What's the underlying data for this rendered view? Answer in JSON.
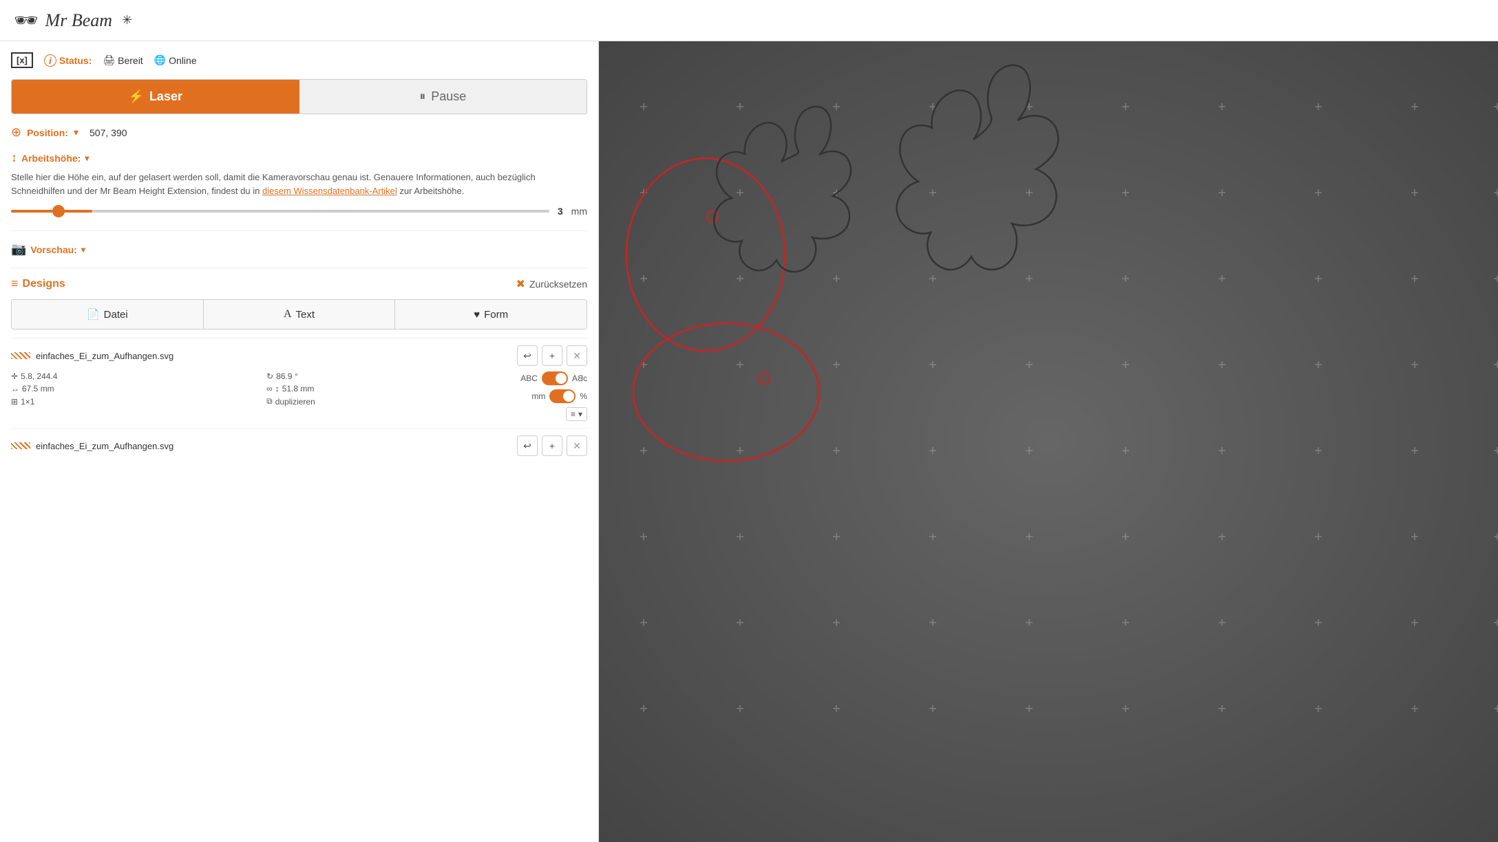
{
  "header": {
    "logo_text": "Mr Beam",
    "logo_glasses": "👓",
    "logo_star": "✳"
  },
  "status_bar": {
    "x_label": "[x]",
    "status_label": "Status:",
    "bereit_label": "Bereit",
    "online_label": "Online"
  },
  "buttons": {
    "laser_label": "Laser",
    "pause_label": "Pause"
  },
  "position": {
    "label": "Position:",
    "value": "507, 390"
  },
  "arbeitshohe": {
    "label": "Arbeitshöhe:",
    "description": "Stelle hier die Höhe ein, auf der gelasert werden soll, damit die Kameravorschau genau ist. Genauere Informationen, auch bezüglich Schneidhilfen und der Mr Beam Height Extension, findest du in ",
    "link_text": "diesem Wissensdatenbank-Artikel",
    "description_suffix": " zur Arbeitshöhe.",
    "slider_value": "3",
    "slider_unit": "mm",
    "slider_min": "0",
    "slider_max": "38",
    "slider_percent": "15"
  },
  "vorschau": {
    "label": "Vorschau:"
  },
  "designs": {
    "label": "Designs",
    "zurucksetzen_label": "Zurücksetzen"
  },
  "tabs": [
    {
      "id": "datei",
      "label": "Datei",
      "icon": "📄"
    },
    {
      "id": "text",
      "label": "Text",
      "icon": "A"
    },
    {
      "id": "form",
      "label": "Form",
      "icon": "♥"
    }
  ],
  "design_items": [
    {
      "name": "einfaches_Ei_zum_Aufhangen.svg",
      "x": "5.8",
      "y": "244.4",
      "rotation": "86.9 °",
      "width": "67.5 mm",
      "height": "51.8 mm",
      "grid": "1×1",
      "abc_label": "ABC",
      "abc_mirror": "ɔBА",
      "mm_label": "mm",
      "percent_label": "%",
      "duplizieren_label": "duplizieren",
      "toggle_abc": true,
      "toggle_mm": true,
      "infinity": "∞"
    },
    {
      "name": "einfaches_Ei_zum_Aufhangen.svg",
      "x": "",
      "y": "",
      "rotation": "",
      "width": "",
      "height": "",
      "grid": "",
      "abc_label": "",
      "abc_mirror": "",
      "mm_label": "",
      "percent_label": "",
      "duplizieren_label": "",
      "toggle_abc": true,
      "toggle_mm": true,
      "infinity": ""
    }
  ],
  "icons": {
    "undo": "↩",
    "add": "+",
    "close": "✕",
    "list": "≡",
    "chevron": "▾",
    "duplicate": "⧉",
    "info": "i",
    "shield": "🌐",
    "printer": "🖨",
    "flash": "⚡",
    "pause_icon": "⏸",
    "camera": "📷",
    "crosshair": "⊕",
    "height_icon": "↕",
    "lock": "∞",
    "rotate": "↻"
  }
}
